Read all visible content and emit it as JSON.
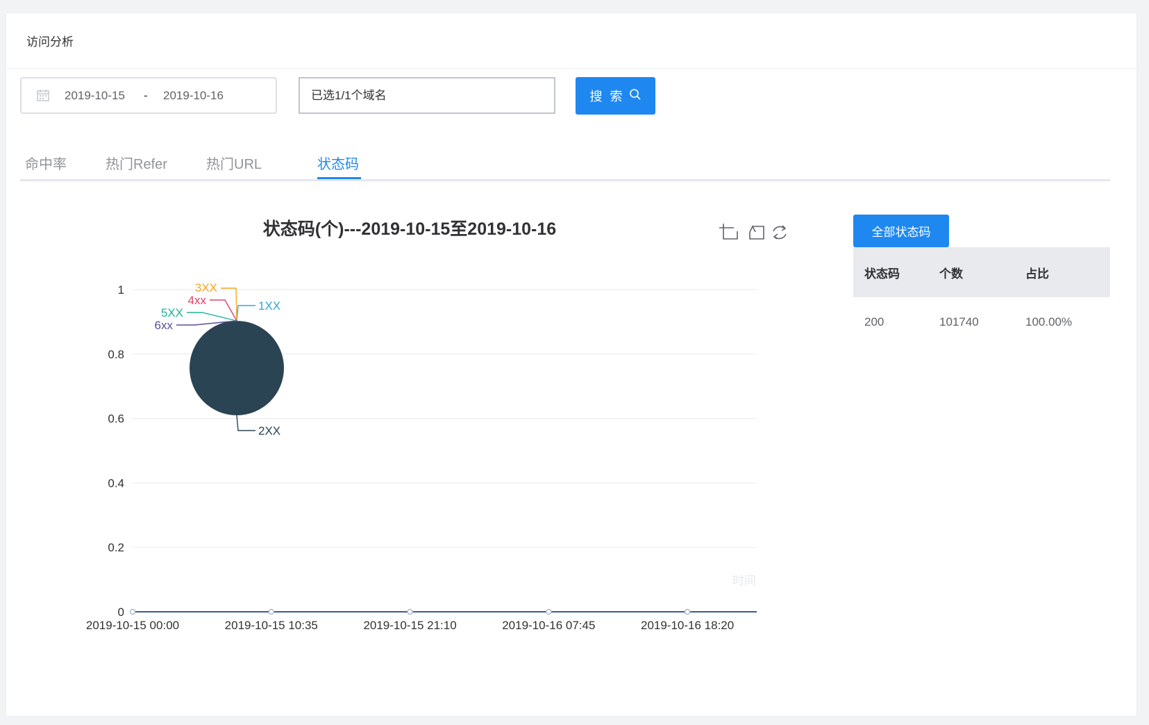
{
  "header": {
    "title": "访问分析"
  },
  "filters": {
    "start_date": "2019-10-15",
    "separator": "-",
    "end_date": "2019-10-16",
    "domain_select": "已选1/1个域名",
    "search_label": "搜 索"
  },
  "tabs": [
    {
      "label": "命中率",
      "active": false
    },
    {
      "label": "热门Refer",
      "active": false
    },
    {
      "label": "热门URL",
      "active": false
    },
    {
      "label": "状态码",
      "active": true
    }
  ],
  "toolbox": [
    "crop-icon",
    "undo-icon",
    "refresh-icon"
  ],
  "chart_data": {
    "type": "line",
    "title": "状态码(个)---2019-10-15至2019-10-16",
    "x_axis_name": "时间",
    "x_ticks": [
      "2019-10-15 00:00",
      "2019-10-15 10:35",
      "2019-10-15 21:10",
      "2019-10-16 07:45",
      "2019-10-16 18:20"
    ],
    "y_ticks": [
      "0",
      "0.2",
      "0.4",
      "0.6",
      "0.8",
      "1"
    ],
    "ylim": [
      0,
      1
    ],
    "grid": true,
    "series": [
      {
        "values": [
          0,
          0,
          0,
          0,
          0
        ]
      }
    ],
    "pie": {
      "type": "pie",
      "labels": [
        "1XX",
        "2XX",
        "3XX",
        "4xx",
        "5XX",
        "6xx"
      ],
      "values": [
        0,
        101740,
        0,
        0,
        0,
        0
      ],
      "colors": [
        "#32a5d8",
        "#2b4453",
        "#f5a623",
        "#e43f68",
        "#1bb39a",
        "#5b4c9a"
      ]
    }
  },
  "side_panel": {
    "button_label": "全部状态码",
    "headers": [
      "状态码",
      "个数",
      "占比"
    ],
    "rows": [
      [
        "200",
        "101740",
        "100.00%"
      ]
    ]
  },
  "colors": {
    "accent": "#1e88f0"
  }
}
